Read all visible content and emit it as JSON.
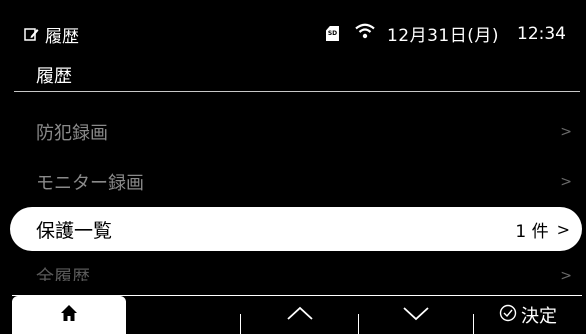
{
  "status": {
    "screen_name": "履歴",
    "sd_label": "SD",
    "date": "12月31日(月)",
    "time": "12:34"
  },
  "title": "履歴",
  "menu": [
    {
      "label": "防犯録画",
      "chevron": ">"
    },
    {
      "label": "モニター録画",
      "chevron": ">"
    },
    {
      "label": "保護一覧",
      "count": "1 件",
      "chevron": ">"
    },
    {
      "label": "全履歴",
      "chevron": ">"
    }
  ],
  "bottom": {
    "confirm": "決定"
  },
  "colors": {
    "background": "#000000",
    "selected_bg": "#ffffff",
    "dim_text": "#8a8a8a"
  }
}
